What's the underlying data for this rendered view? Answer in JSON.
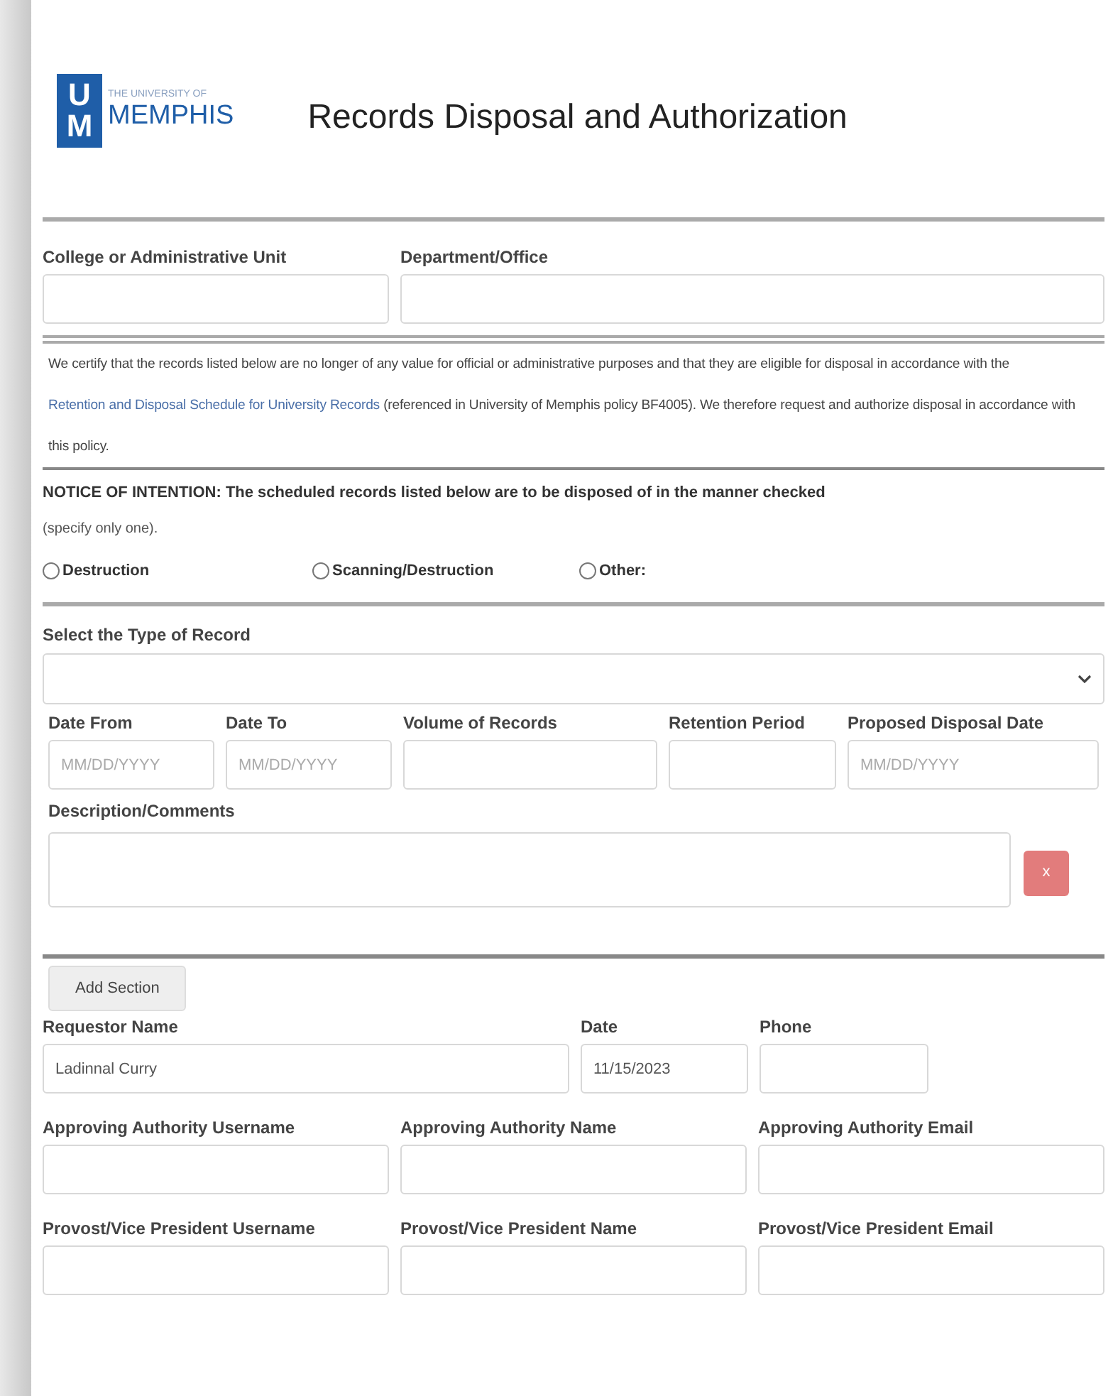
{
  "logo": {
    "mark_top": "U",
    "mark_bottom": "M",
    "small": "THE UNIVERSITY OF",
    "name": "MEMPHIS"
  },
  "title": "Records Disposal and Authorization",
  "unit_fields": [
    {
      "label": "College or Administrative Unit"
    },
    {
      "label": "Department/Office"
    }
  ],
  "certification": {
    "before": "We certify that the records listed below are no longer of any value for official or administrative purposes and that they are eligible for disposal in accordance with the ",
    "link": "Retention and Disposal Schedule for University Records",
    "after": " (referenced in University of Memphis policy BF4005). We therefore request and authorize disposal in accordance with this policy."
  },
  "notice": {
    "text": "NOTICE OF INTENTION: The scheduled records listed below are to be disposed of in the manner checked",
    "note": "(specify only one)."
  },
  "methods": [
    {
      "label": "Destruction",
      "selected": false
    },
    {
      "label": "Scanning/Destruction",
      "selected": false
    },
    {
      "label": "Other:",
      "selected": false
    }
  ],
  "record_type": {
    "label": "Select the Type of Record"
  },
  "record_fields": [
    {
      "label": "Date From",
      "placeholder": "MM/DD/YYYY"
    },
    {
      "label": "Date To",
      "placeholder": "MM/DD/YYYY"
    },
    {
      "label": "Volume of Records"
    },
    {
      "label": "Retention Period"
    },
    {
      "label": "Proposed Disposal Date",
      "placeholder": "MM/DD/YYYY"
    }
  ],
  "description": {
    "label": "Description/Comments",
    "remove_button": "x"
  },
  "add_section_button": "Add Section",
  "requestor_fields": [
    {
      "label": "Requestor Name",
      "value": "Ladinnal Curry"
    },
    {
      "label": "Date",
      "value": "11/15/2023"
    },
    {
      "label": "Phone"
    }
  ],
  "approval_rows": [
    [
      {
        "label": "Approving Authority Username"
      },
      {
        "label": "Approving Authority Name"
      },
      {
        "label": "Approving Authority Email"
      }
    ],
    [
      {
        "label": "Provost/Vice President Username"
      },
      {
        "label": "Provost/Vice President Name"
      },
      {
        "label": "Provost/Vice President Email"
      }
    ]
  ]
}
